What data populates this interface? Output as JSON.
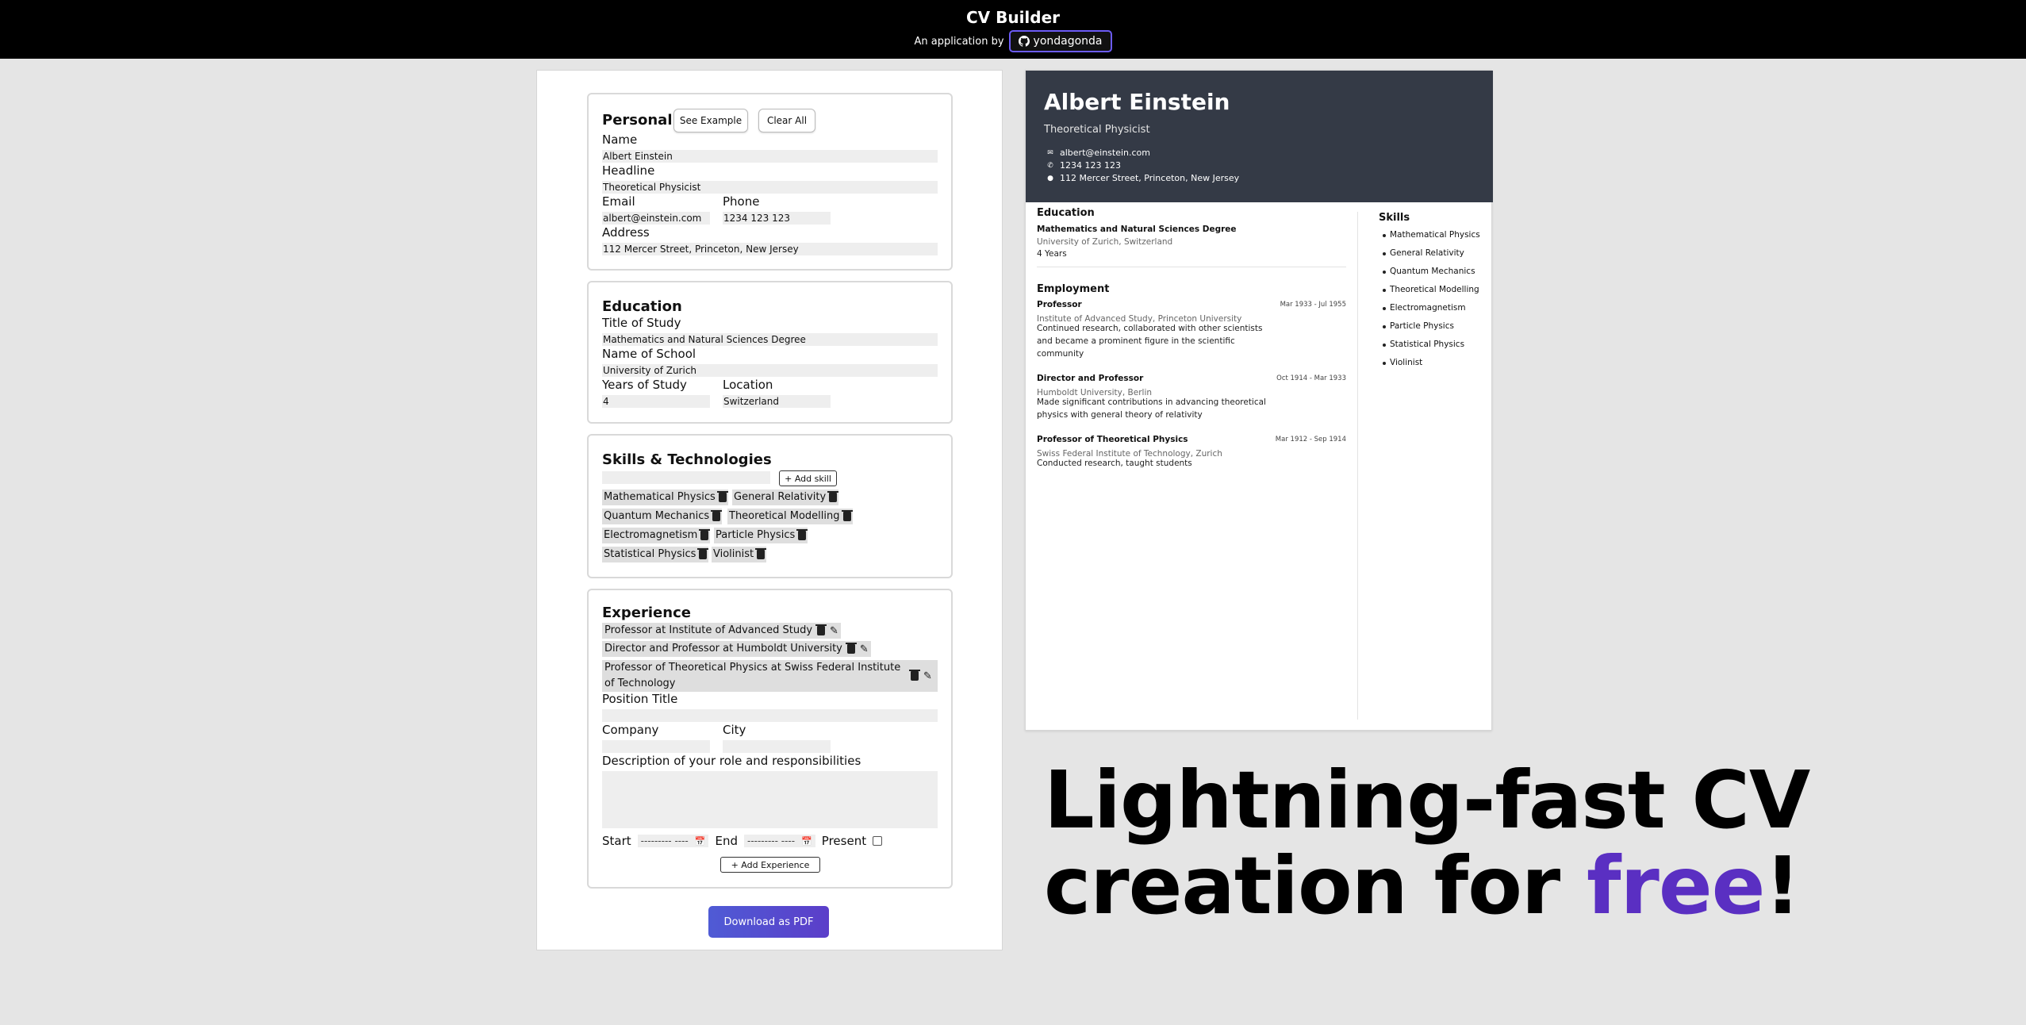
{
  "header": {
    "title": "CV Builder",
    "byline": "An application by",
    "github_user": "yondagonda"
  },
  "colors": {
    "accent": "#5a2fc2",
    "header_bg": "#000000",
    "cv_header_bg": "#343a46"
  },
  "personal": {
    "heading": "Personal",
    "see_example": "See Example",
    "clear_all": "Clear All",
    "name_label": "Name",
    "name_value": "Albert Einstein",
    "headline_label": "Headline",
    "headline_value": "Theoretical Physicist",
    "email_label": "Email",
    "email_value": "albert@einstein.com",
    "phone_label": "Phone",
    "phone_value": "1234 123 123",
    "address_label": "Address",
    "address_value": "112 Mercer Street, Princeton, New Jersey"
  },
  "education": {
    "heading": "Education",
    "title_label": "Title of Study",
    "title_value": "Mathematics and Natural Sciences Degree",
    "school_label": "Name of School",
    "school_value": "University of Zurich",
    "years_label": "Years of Study",
    "years_value": "4",
    "location_label": "Location",
    "location_value": "Switzerland"
  },
  "skills": {
    "heading": "Skills & Technologies",
    "add_label": "+ Add skill",
    "items": [
      "Mathematical Physics",
      "General Relativity",
      "Quantum Mechanics",
      "Theoretical Modelling",
      "Electromagnetism",
      "Particle Physics",
      "Statistical Physics",
      "Violinist"
    ]
  },
  "experience": {
    "heading": "Experience",
    "entries": [
      "Professor at Institute of Advanced Study",
      "Director and Professor at Humboldt University",
      "Professor of Theoretical Physics at Swiss Federal Institute of Technology"
    ],
    "position_label": "Position Title",
    "company_label": "Company",
    "city_label": "City",
    "description_label": "Description of your role and responsibilities",
    "start_label": "Start",
    "end_label": "End",
    "date_placeholder": "--------- ----",
    "present_label": "Present",
    "add_label": "+ Add Experience"
  },
  "download_label": "Download as PDF",
  "cv": {
    "name": "Albert Einstein",
    "headline": "Theoretical Physicist",
    "email": "albert@einstein.com",
    "phone": "1234 123 123",
    "address": "112 Mercer Street, Princeton, New Jersey",
    "education_heading": "Education",
    "edu_title": "Mathematics and Natural Sciences Degree",
    "edu_school": "University of Zurich, Switzerland",
    "edu_years": "4 Years",
    "employment_heading": "Employment",
    "jobs": [
      {
        "title": "Professor",
        "dates": "Mar 1933 - Jul 1955",
        "company": "Institute of Advanced Study, Princeton University",
        "desc": [
          "Continued research, collaborated with other scientists",
          "and became a prominent figure in the scientific",
          "community"
        ]
      },
      {
        "title": "Director and Professor",
        "dates": "Oct 1914 - Mar 1933",
        "company": "Humboldt University, Berlin",
        "desc": [
          "Made significant contributions in advancing theoretical",
          "physics with general theory of relativity"
        ]
      },
      {
        "title": "Professor of Theoretical Physics",
        "dates": "Mar 1912 - Sep 1914",
        "company": "Swiss Federal Institute of Technology, Zurich",
        "desc": [
          "Conducted research, taught students"
        ]
      }
    ],
    "skills_heading": "Skills",
    "skills": [
      "Mathematical Physics",
      "General Relativity",
      "Quantum Mechanics",
      "Theoretical Modelling",
      "Electromagnetism",
      "Particle Physics",
      "Statistical Physics",
      "Violinist"
    ]
  },
  "tagline": {
    "line1": "Lightning-fast CV",
    "line2_pre": "creation for ",
    "line2_accent": "free",
    "line2_post": "!"
  }
}
